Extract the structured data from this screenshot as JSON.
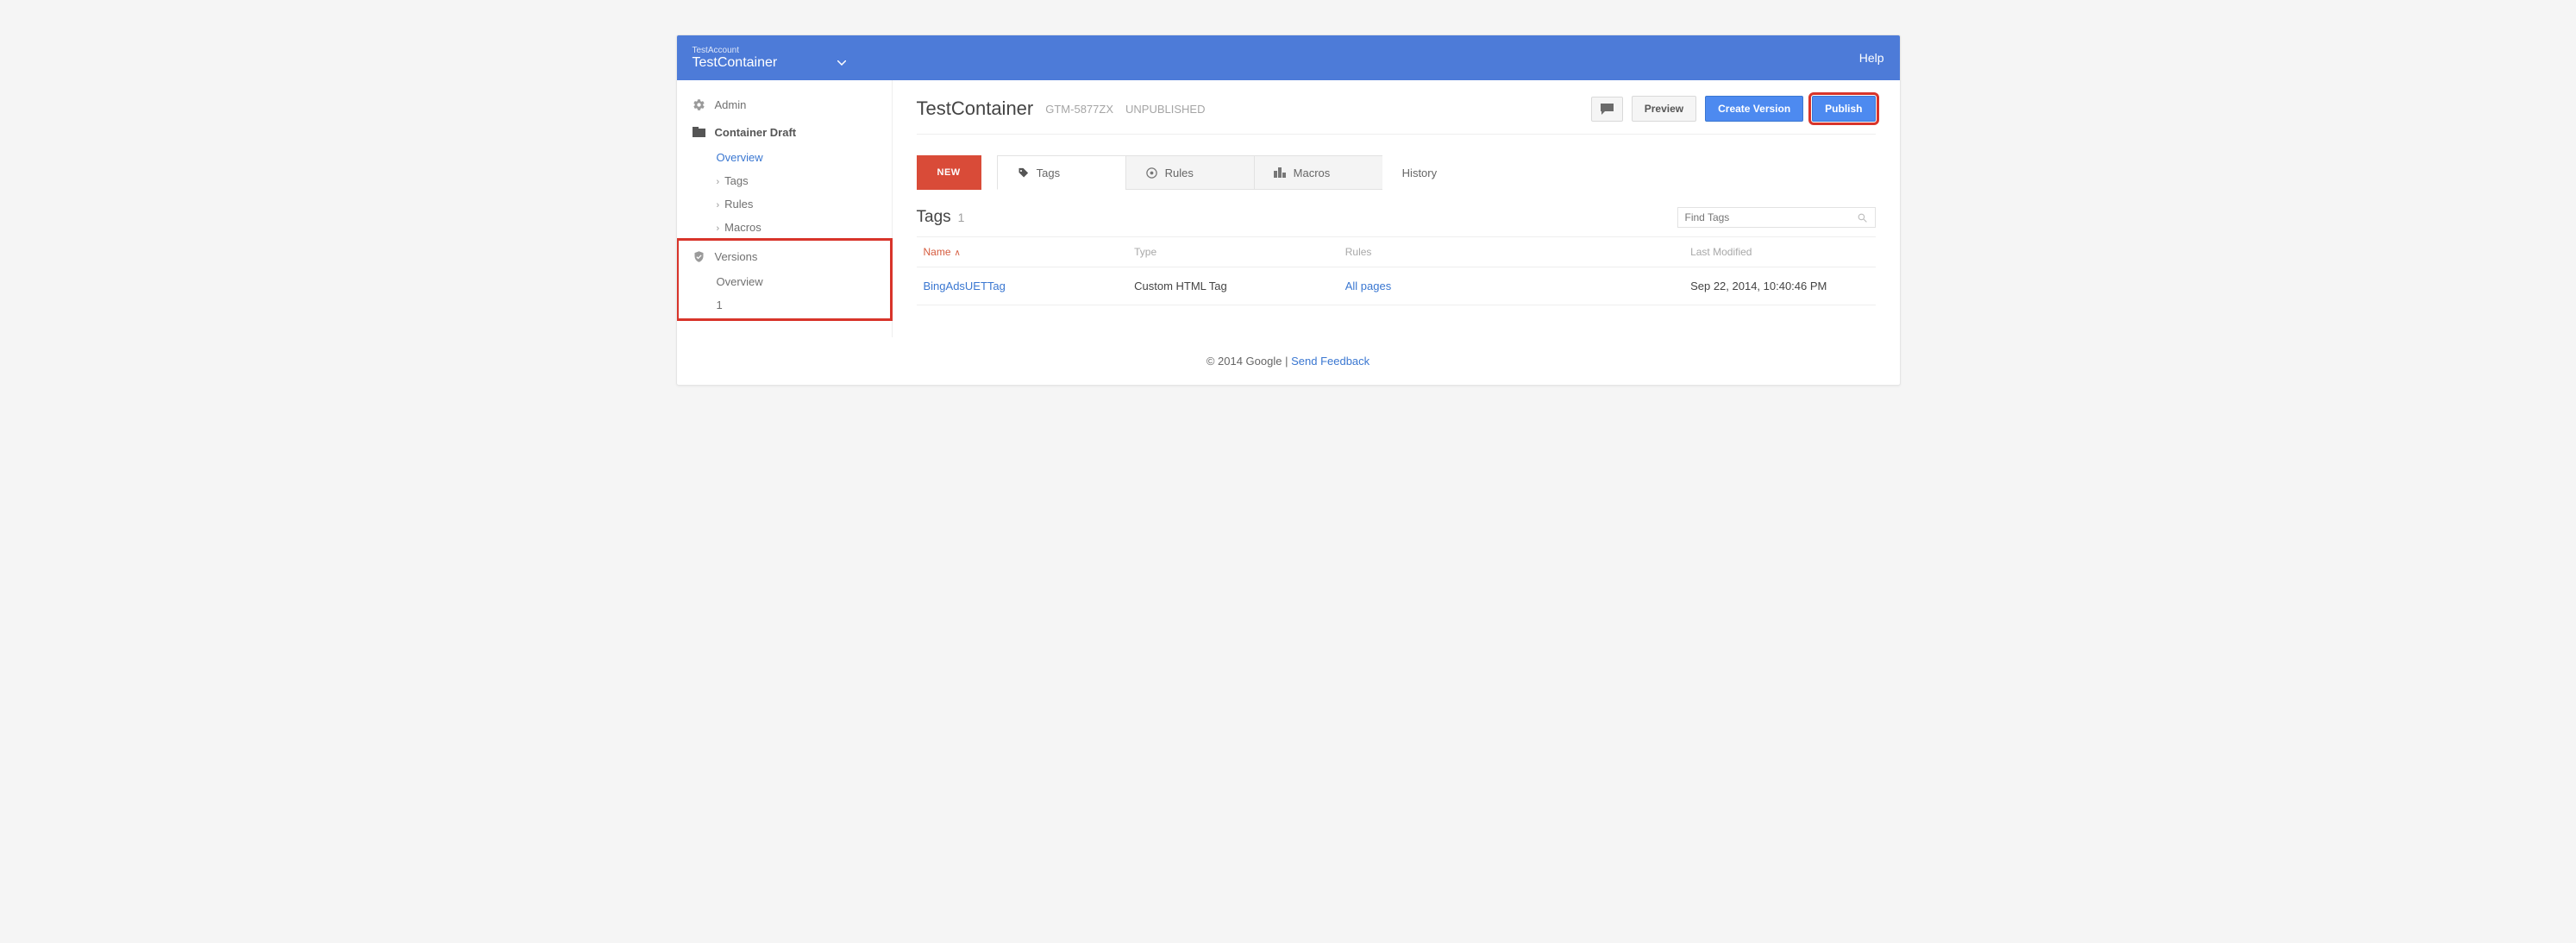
{
  "topbar": {
    "account_label": "TestAccount",
    "container_label": "TestContainer",
    "help_label": "Help"
  },
  "sidebar": {
    "admin_label": "Admin",
    "draft": {
      "header": "Container Draft",
      "overview": "Overview",
      "tags": "Tags",
      "rules": "Rules",
      "macros": "Macros"
    },
    "versions": {
      "header": "Versions",
      "overview": "Overview",
      "item1": "1"
    }
  },
  "header": {
    "title": "TestContainer",
    "container_id": "GTM-5877ZX",
    "status": "UNPUBLISHED",
    "preview_label": "Preview",
    "create_version_label": "Create Version",
    "publish_label": "Publish"
  },
  "tabs": {
    "new_label": "NEW",
    "tags": "Tags",
    "rules": "Rules",
    "macros": "Macros",
    "history": "History"
  },
  "section": {
    "title": "Tags",
    "count": "1",
    "search_placeholder": "Find Tags"
  },
  "table": {
    "cols": {
      "name": "Name",
      "type": "Type",
      "rules": "Rules",
      "modified": "Last Modified"
    },
    "rows": [
      {
        "name": "BingAdsUETTag",
        "type": "Custom HTML Tag",
        "rules": "All pages",
        "modified": "Sep 22, 2014, 10:40:46 PM"
      }
    ]
  },
  "footer": {
    "copyright": "© 2014 Google",
    "separator": " | ",
    "feedback": "Send Feedback"
  }
}
